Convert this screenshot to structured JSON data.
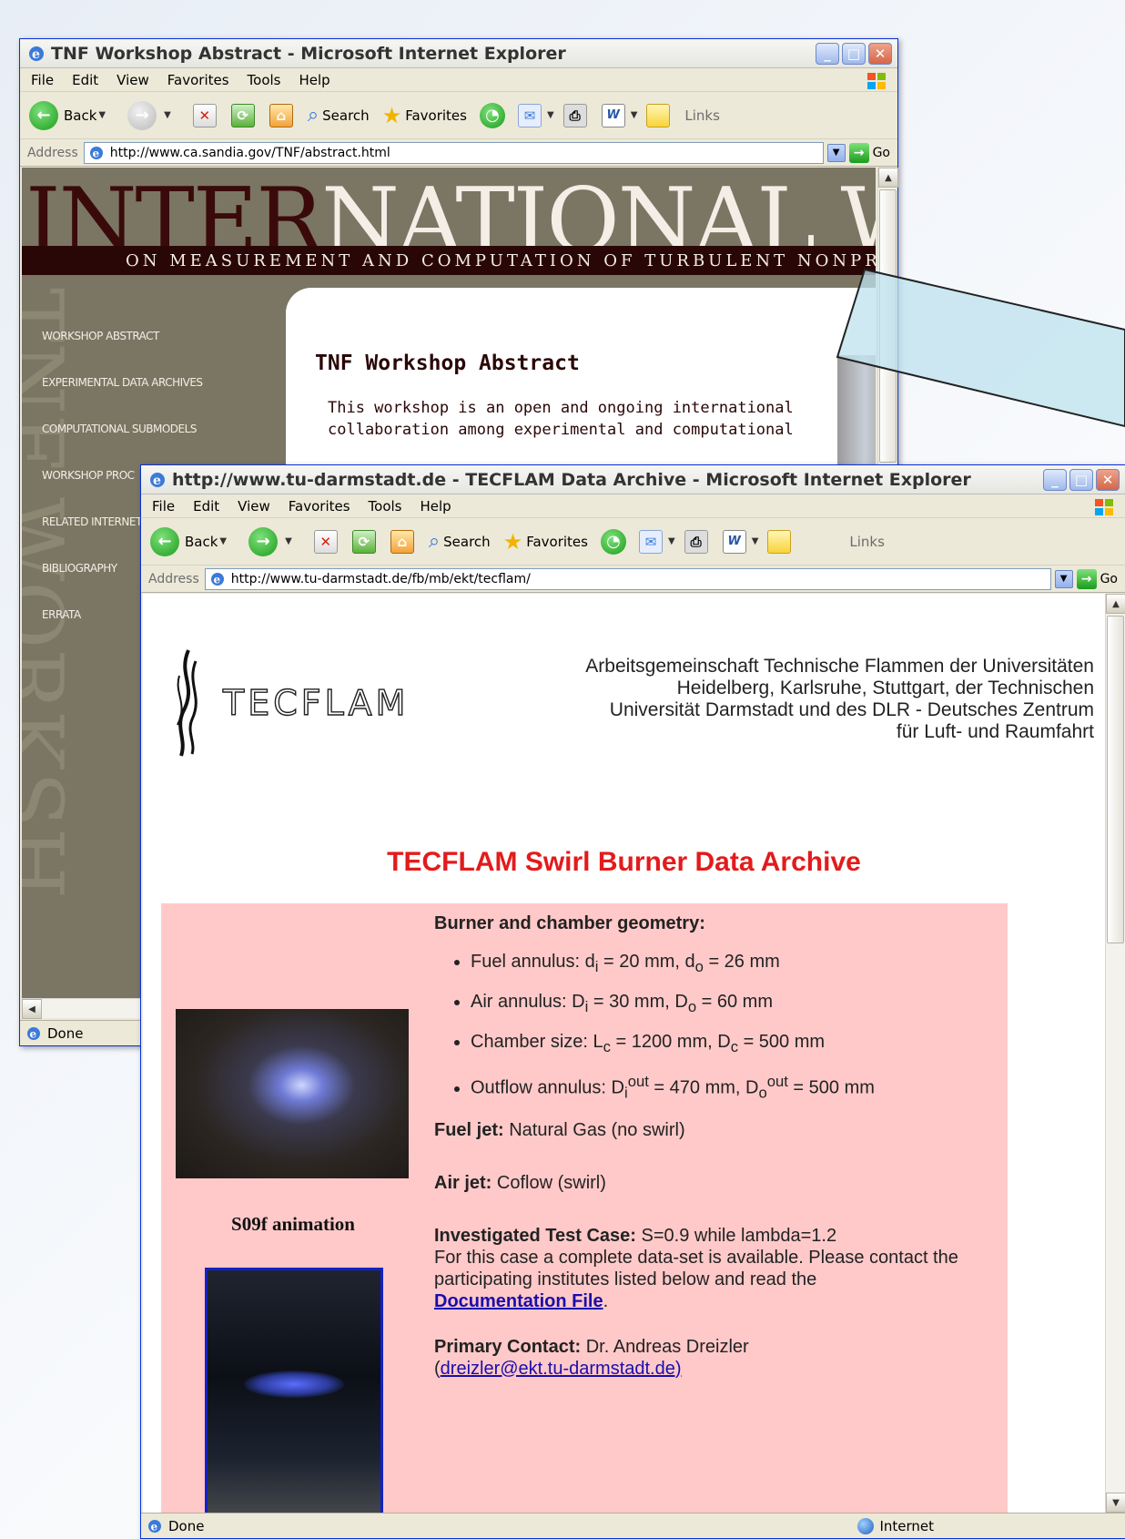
{
  "window1": {
    "title": "TNF Workshop Abstract - Microsoft Internet Explorer",
    "menu": [
      "File",
      "Edit",
      "View",
      "Favorites",
      "Tools",
      "Help"
    ],
    "toolbar": {
      "back": "Back",
      "search": "Search",
      "favorites": "Favorites",
      "links": "Links"
    },
    "address_label": "Address",
    "url": "http://www.ca.sandia.gov/TNF/abstract.html",
    "go": "Go",
    "banner_dark": "INTER",
    "banner_light": "NATIONAL WORK",
    "banner_sub": "ON MEASUREMENT AND COMPUTATION OF TURBULENT NONPREMIX",
    "nav": [
      "WORKSHOP ABSTRACT",
      "EXPERIMENTAL DATA ARCHIVES",
      "COMPUTATIONAL SUBMODELS",
      "WORKSHOP PROC",
      "RELATED INTERNET",
      "BIBLIOGRAPHY",
      "ERRATA"
    ],
    "vertical_word": "TNF WORKSH",
    "heading": "TNF Workshop Abstract",
    "body": "This workshop is an open and ongoing international collaboration among experimental and computational",
    "status": "Done"
  },
  "window2": {
    "title": "http://www.tu-darmstadt.de - TECFLAM Data Archive - Microsoft Internet Explorer",
    "menu": [
      "File",
      "Edit",
      "View",
      "Favorites",
      "Tools",
      "Help"
    ],
    "toolbar": {
      "back": "Back",
      "search": "Search",
      "favorites": "Favorites",
      "links": "Links"
    },
    "address_label": "Address",
    "url": "http://www.tu-darmstadt.de/fb/mb/ekt/tecflam/",
    "go": "Go",
    "logo": "TECFLAM",
    "institutes": "Arbeitsgemeinschaft Technische Flammen der Universitäten Heidelberg, Karlsruhe, Stuttgart, der Technischen Universität Darmstadt und des DLR - Deutsches Zentrum für Luft- und Raumfahrt",
    "archive_title": "TECFLAM Swirl Burner Data Archive",
    "geometry_heading": "Burner and chamber geometry:",
    "geometry": [
      {
        "label": "Fuel annulus: ",
        "a": "d",
        "a_sub": "i",
        "a_val": " = 20 mm, ",
        "b": "d",
        "b_sub": "o",
        "b_val": " = 26 mm"
      },
      {
        "label": "Air annulus: ",
        "a": "D",
        "a_sub": "i",
        "a_val": " = 30 mm, ",
        "b": "D",
        "b_sub": "o",
        "b_val": " = 60 mm"
      },
      {
        "label": "Chamber size: ",
        "a": "L",
        "a_sub": "c",
        "a_val": " = 1200 mm, ",
        "b": "D",
        "b_sub": "c",
        "b_val": " = 500 mm"
      },
      {
        "label": "Outflow annulus: ",
        "a": "D",
        "a_sub": "i",
        "a_sup": "out",
        "a_val": " = 470 mm, ",
        "b": "D",
        "b_sub": "o",
        "b_sup": "out",
        "b_val": " = 500 mm"
      }
    ],
    "fuel_label": "Fuel jet:",
    "fuel_value": " Natural Gas (no swirl)",
    "air_label": "Air jet:",
    "air_value": " Coflow (swirl)",
    "case_label": "Investigated Test Case:",
    "case_value": " S=0.9 while lambda=1.2",
    "case_text": "For this case a complete data-set is available. Please contact the participating institutes listed below and read the",
    "doc_link": "Documentation File",
    "contact_label": "Primary Contact:",
    "contact_value": " Dr. Andreas Dreizler",
    "contact_email": "dreizler@ekt.tu-darmstadt.de)",
    "caption": "S09f animation",
    "status": "Done",
    "zone": "Internet"
  }
}
